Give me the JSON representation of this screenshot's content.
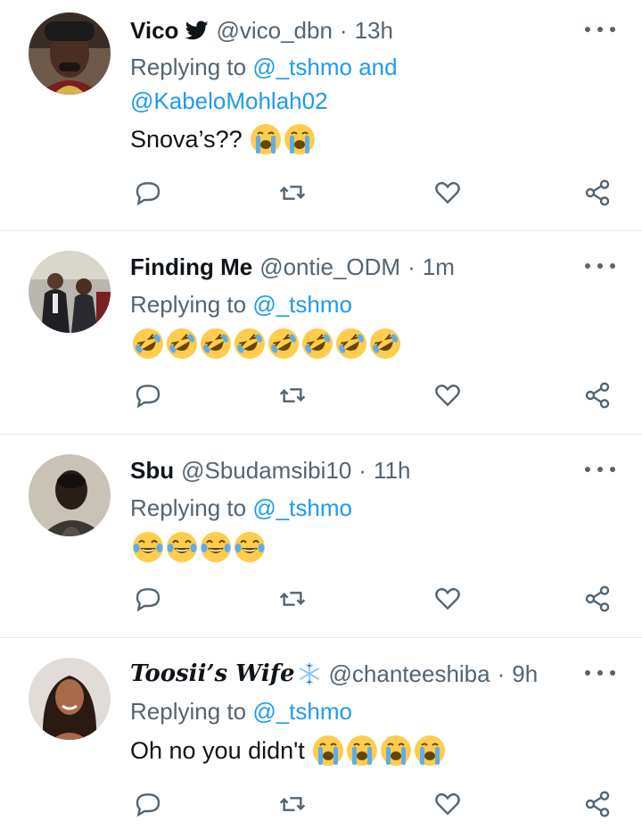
{
  "tweets": [
    {
      "name": "Vico",
      "verified_bird": true,
      "handle": "@vico_dbn",
      "separator": "·",
      "time": "13h",
      "replying_prefix": "Replying to",
      "mention_1": "@_tshmo",
      "and": "and",
      "mention_2": "@KabeloMohlah02",
      "text": "Snova’s??",
      "emojis": [
        "loudly-crying-face",
        "loudly-crying-face"
      ]
    },
    {
      "name": "Finding Me",
      "handle": "@ontie_ODM",
      "separator": "·",
      "time": "1m",
      "replying_prefix": "Replying to",
      "mention_1": "@_tshmo",
      "text": "",
      "emojis": [
        "rolling-on-floor-laughing",
        "rolling-on-floor-laughing",
        "rolling-on-floor-laughing",
        "rolling-on-floor-laughing",
        "rolling-on-floor-laughing",
        "rolling-on-floor-laughing",
        "rolling-on-floor-laughing",
        "rolling-on-floor-laughing"
      ]
    },
    {
      "name": "Sbu",
      "handle": "@Sbudamsibi10",
      "separator": "·",
      "time": "11h",
      "replying_prefix": "Replying to",
      "mention_1": "@_tshmo",
      "text": "",
      "emojis": [
        "face-with-tears-of-joy",
        "face-with-tears-of-joy",
        "face-with-tears-of-joy",
        "face-with-tears-of-joy"
      ]
    },
    {
      "name": "Toosii’s Wife",
      "name_suffix_icon": "snowflake-icon",
      "handle": "@chanteeshiba",
      "separator": "·",
      "time": "9h",
      "replying_prefix": "Replying to",
      "mention_1": "@_tshmo",
      "text": "Oh no you didn't",
      "emojis": [
        "loudly-crying-face",
        "loudly-crying-face",
        "loudly-crying-face",
        "loudly-crying-face"
      ]
    }
  ],
  "colors": {
    "text": "#0f1419",
    "secondary": "#536471",
    "link": "#1d9bf0",
    "divider": "#e6e9ec",
    "bird": "#0f1419"
  }
}
